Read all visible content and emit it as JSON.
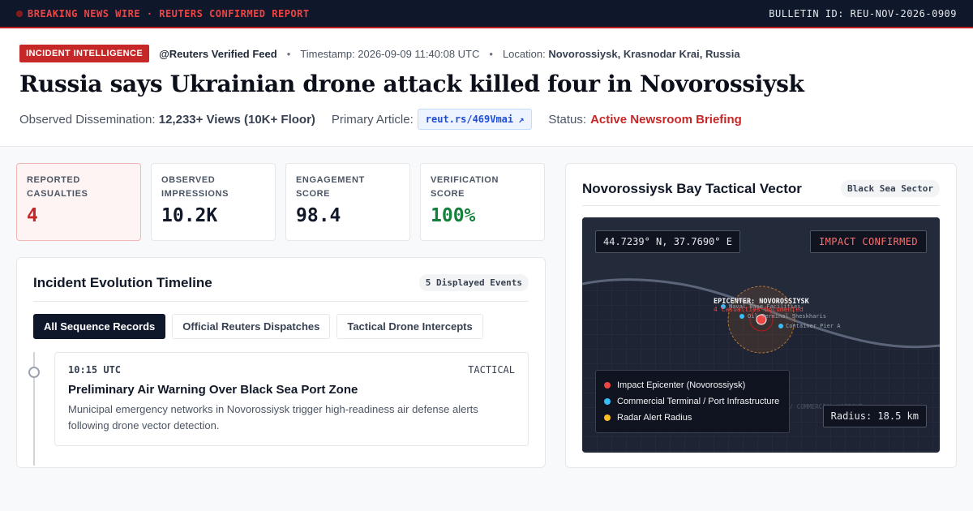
{
  "topbar": {
    "wire_label": "BREAKING NEWS WIRE · REUTERS CONFIRMED REPORT",
    "bulletin_id": "BULLETIN ID: REU-NOV-2026-0909"
  },
  "header": {
    "tag": "INCIDENT INTELLIGENCE",
    "feed": "@Reuters Verified Feed",
    "separator": "•",
    "timestamp_label": "Timestamp: 2026-09-09 11:40:08 UTC",
    "location_label": "Location:",
    "location_value": "Novorossiysk, Krasnodar Krai, Russia",
    "headline": "Russia says Ukrainian drone attack killed four in Novorossiysk",
    "dissemination_label": "Observed Dissemination:",
    "dissemination_value": "12,233+ Views (10K+ Floor)",
    "article_label": "Primary Article:",
    "article_link": "reut.rs/469Vmai",
    "article_link_icon": "↗",
    "status_label": "Status:",
    "status_value": "Active Newsroom Briefing"
  },
  "stats": [
    {
      "label": "REPORTED CASUALTIES",
      "value": "4"
    },
    {
      "label": "OBSERVED IMPRESSIONS",
      "value": "10.2K"
    },
    {
      "label": "ENGAGEMENT SCORE",
      "value": "98.4"
    },
    {
      "label": "VERIFICATION SCORE",
      "value": "100%"
    }
  ],
  "timeline": {
    "title": "Incident Evolution Timeline",
    "count": "5 Displayed Events",
    "filters": [
      "All Sequence Records",
      "Official Reuters Dispatches",
      "Tactical Drone Intercepts"
    ],
    "events": [
      {
        "time": "10:15 UTC",
        "type": "TACTICAL",
        "title": "Preliminary Air Warning Over Black Sea Port Zone",
        "desc": "Municipal emergency networks in Novorossiysk trigger high-readiness air defense alerts following drone vector detection."
      }
    ]
  },
  "map": {
    "title": "Novorossiysk Bay Tactical Vector",
    "sector": "Black Sea Sector",
    "coords": "44.7239° N, 37.7690° E",
    "impact": "IMPACT CONFIRMED",
    "epicenter_label": "EPICENTER: NOVOROSSIYSK",
    "epicenter_sub": "4 Casualties Documented",
    "poi_1": "Naval Base Facilities",
    "poi_2": "Oil Terminal Sheskharis",
    "poi_3": "Container Pier A",
    "faint_label": "INDUSTRIAL / COMMERCIAL HARBOUR",
    "legend": [
      {
        "label": "Impact Epicenter (Novorossiysk)",
        "color": "#ef4444"
      },
      {
        "label": "Commercial Terminal / Port Infrastructure",
        "color": "#38bdf8"
      },
      {
        "label": "Radar Alert Radius",
        "color": "#fbbf24"
      }
    ],
    "radius": "Radius: 18.5 km"
  }
}
